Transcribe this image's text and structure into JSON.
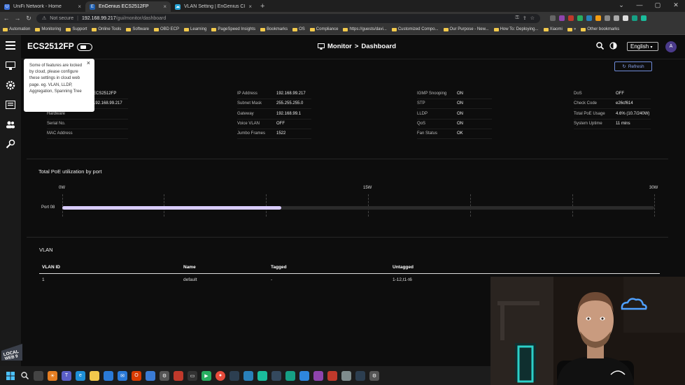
{
  "browser": {
    "tabs": [
      {
        "title": "UniFi Network - Home",
        "active": false,
        "fav_color": "#3a6fd8"
      },
      {
        "title": "EnGenius ECS2512FP",
        "active": true,
        "fav_color": "#1f5fb0"
      },
      {
        "title": "VLAN Setting | EnGenius Cloud",
        "active": false,
        "fav_color": "#2aa6d8"
      }
    ],
    "new_tab": "+",
    "address": {
      "security": "Not secure",
      "host": "192.168.99.217",
      "path": "/gui/monitor/dashboard"
    },
    "bookmarks": [
      "Automation",
      "Monitoring",
      "Support",
      "Online Tools",
      "Software",
      "OBD ECP",
      "Learning",
      "PageSpeed Insights",
      "Bookmarks",
      "OS",
      "Compliance",
      "https://guests/davi...",
      "Customized Compo...",
      "Our Purpose - New...",
      "How To: Deploying...",
      "Xiaomi",
      "»",
      "Other bookmarks"
    ]
  },
  "app": {
    "device_name": "ECS2512FP",
    "breadcrumb": {
      "section": "Monitor",
      "separator": ">",
      "page": "Dashboard"
    },
    "language": "English",
    "avatar_initial": "A",
    "refresh_label": "Refresh",
    "tooltip": {
      "text": "Some of features are locked by cloud, please configure these settings in cloud web page. eg. VLAN, LLDP, Aggregation, Spanning Tree",
      "close": "×"
    },
    "info_col1": [
      {
        "key": "",
        "value": "ECS2512FP"
      },
      {
        "key": "",
        "value": "192.168.99.217"
      },
      {
        "key": "Hardware",
        "value": ""
      },
      {
        "key": "Serial No.",
        "value": ""
      },
      {
        "key": "MAC Address",
        "value": ""
      }
    ],
    "info_col2": [
      {
        "key": "IP Address",
        "value": "192.168.99.217"
      },
      {
        "key": "Subnet Mask",
        "value": "255.255.255.0"
      },
      {
        "key": "Gateway",
        "value": "192.168.99.1"
      },
      {
        "key": "Voice VLAN",
        "value": "OFF"
      },
      {
        "key": "Jumbo Frames",
        "value": "1522"
      }
    ],
    "info_col3": [
      {
        "key": "IGMP Snooping",
        "value": "ON"
      },
      {
        "key": "STP",
        "value": "ON"
      },
      {
        "key": "LLDP",
        "value": "ON"
      },
      {
        "key": "QoS",
        "value": "ON"
      },
      {
        "key": "Fan Status",
        "value": "OK"
      }
    ],
    "info_col4": [
      {
        "key": "DoS",
        "value": "OFF"
      },
      {
        "key": "Check Code",
        "value": "e26cf614"
      },
      {
        "key": "Total PoE Usage",
        "value": "4.6% (10.7/240W)"
      },
      {
        "key": "System Uptime",
        "value": "11 mins"
      }
    ],
    "poe": {
      "title": "Total PoE utilization by port",
      "axis_ticks": [
        "0W",
        "15W",
        "30W"
      ],
      "port_label": "Port 08",
      "utilization_fraction": 0.37
    },
    "vlan": {
      "title": "VLAN",
      "columns": [
        "VLAN ID",
        "Name",
        "Tagged",
        "Untagged"
      ],
      "rows": [
        [
          "1",
          "default",
          "-",
          "1-12,t1-t6"
        ]
      ]
    },
    "overlay_logo": "LOCAL WEB 9"
  },
  "colors": {
    "accent": "#8aa4ee",
    "poe_fill": "#d9ccff",
    "app_bg": "#0d0d0d"
  }
}
